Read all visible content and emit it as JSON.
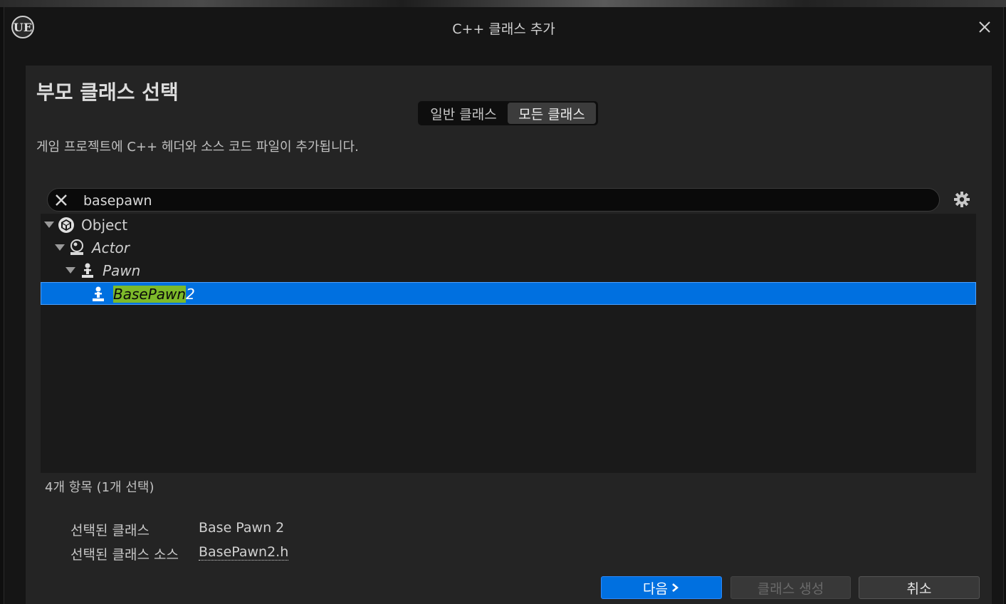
{
  "window": {
    "title": "C++ 클래스 추가",
    "logo": "UE"
  },
  "panel": {
    "heading": "부모 클래스 선택",
    "tabs": [
      {
        "label": "일반 클래스",
        "selected": false
      },
      {
        "label": "모든 클래스",
        "selected": true
      }
    ],
    "description": "게임 프로젝트에 C++ 헤더와 소스 코드 파일이 추가됩니다."
  },
  "search": {
    "value": "basepawn",
    "clear_icon": "close-icon",
    "settings_icon": "gear-icon"
  },
  "tree": {
    "items": [
      {
        "label": "Object",
        "icon": "object-cube-icon",
        "italic": false,
        "expanded": true,
        "selected": false
      },
      {
        "label": "Actor",
        "icon": "actor-icon",
        "italic": true,
        "expanded": true,
        "selected": false
      },
      {
        "label": "Pawn",
        "icon": "pawn-icon",
        "italic": true,
        "expanded": true,
        "selected": false
      },
      {
        "label": "BasePawn2",
        "match": "BasePawn",
        "rest": "2",
        "icon": "pawn-icon",
        "italic": true,
        "expanded": false,
        "selected": true
      }
    ]
  },
  "status": {
    "count": "4개 항목 (1개 선택)"
  },
  "info": {
    "selected_class_label": "선택된 클래스",
    "selected_class_value": "Base Pawn 2",
    "selected_source_label": "선택된 클래스 소스",
    "selected_source_value": "BasePawn2.h"
  },
  "buttons": {
    "next": "다음",
    "create": "클래스 생성",
    "cancel": "취소"
  },
  "colors": {
    "accent": "#0070e0",
    "highlight": "#7dba2a"
  }
}
